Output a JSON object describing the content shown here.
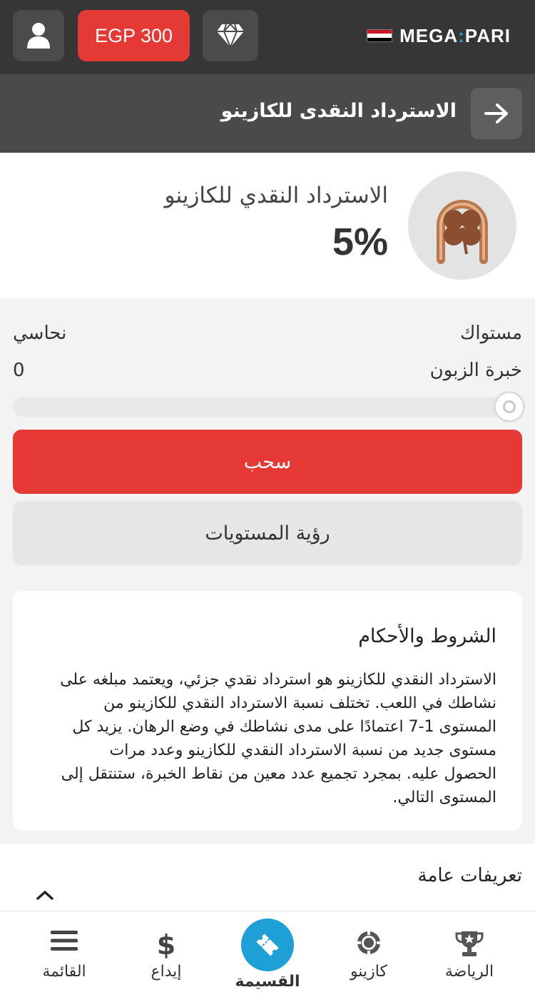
{
  "topbar": {
    "balance": "EGP 300",
    "brand_left": "MEGA",
    "brand_right": "PARI",
    "flag_colors": [
      "#ce1126",
      "#ffffff",
      "#000000"
    ]
  },
  "header": {
    "title": "الاسترداد النقدى للكازينو"
  },
  "cashback": {
    "name": "الاسترداد النقدي للكازينو",
    "percent": "5%"
  },
  "level": {
    "level_label": "مستواك",
    "level_value": "نحاسي",
    "exp_label": "خبرة الزبون",
    "exp_value": "0",
    "progress": 0
  },
  "buttons": {
    "withdraw": "سحب",
    "view_levels": "رؤية المستويات"
  },
  "terms": {
    "title": "الشروط والأحكام",
    "body": "الاسترداد النقدي للكازينو هو استرداد نقدي جزئي، ويعتمد مبلغه على نشاطك في اللعب. تختلف نسبة الاسترداد النقدي للكازينو من المستوى 1-7 اعتمادًا على مدى نشاطك في وضع الرهان. يزيد كل مستوى جديد من نسبة الاسترداد النقدي للكازينو وعدد مرات الحصول عليه. بمجرد تجميع عدد معين من نقاط الخبرة، ستنتقل إلى المستوى التالي."
  },
  "definitions": {
    "title": "تعريفات عامة"
  },
  "bottom_nav": {
    "sports": "الرياضة",
    "casino": "كازينو",
    "coupon": "القسيمة",
    "deposit": "إيداع",
    "menu": "القائمة"
  },
  "colors": {
    "accent_red": "#e53935",
    "active_blue": "#1e9fd6",
    "topbar": "#363636"
  }
}
